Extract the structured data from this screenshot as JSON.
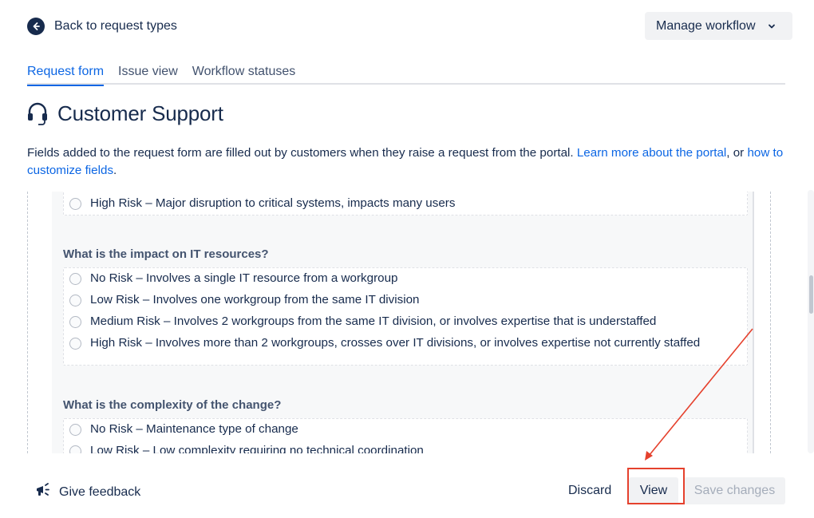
{
  "header": {
    "back_label": "Back to request types",
    "manage_label": "Manage workflow"
  },
  "tabs": [
    {
      "label": "Request form",
      "active": true
    },
    {
      "label": "Issue view",
      "active": false
    },
    {
      "label": "Workflow statuses",
      "active": false
    }
  ],
  "page": {
    "title": "Customer Support",
    "icon": "headset-icon",
    "description": {
      "text_before": "Fields added to the request form are filled out by customers when they raise a request from the portal. ",
      "link1": "Learn more about the portal",
      "text_middle": ", or ",
      "link2": "how to customize fields",
      "text_after": "."
    }
  },
  "form": {
    "prev_option": "High Risk – Major disruption to critical systems, impacts many users",
    "questions": [
      {
        "label": "What is the impact on IT resources?",
        "options": [
          "No Risk – Involves a single IT resource from a workgroup",
          "Low Risk – Involves one workgroup from the same IT division",
          "Medium Risk – Involves 2 workgroups from the same IT division, or involves expertise that is understaffed",
          "High Risk – Involves more than 2 workgroups, crosses over IT divisions, or involves expertise not currently staffed"
        ]
      },
      {
        "label": "What is the complexity of the change?",
        "options": [
          "No Risk – Maintenance type of change",
          "Low Risk – Low complexity requiring no technical coordination"
        ]
      }
    ]
  },
  "footer": {
    "feedback_label": "Give feedback",
    "discard_label": "Discard",
    "view_label": "View",
    "save_label": "Save changes"
  },
  "colors": {
    "accent": "#0c66e4",
    "text": "#172b4d",
    "annotation": "#e5412d"
  }
}
